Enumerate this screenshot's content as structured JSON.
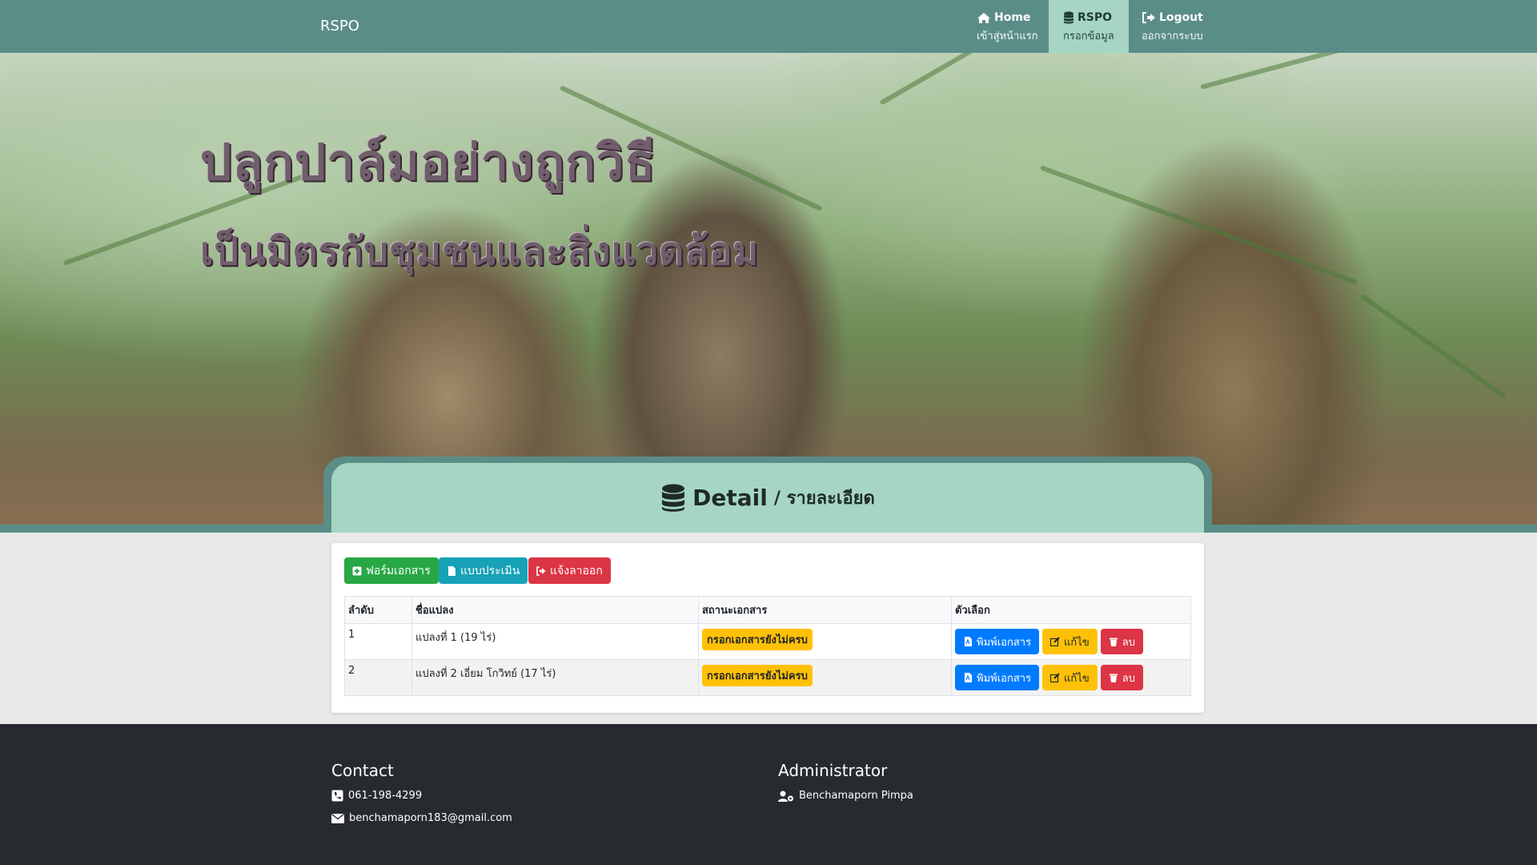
{
  "navbar": {
    "brand": "RSPO",
    "items": [
      {
        "label": "Home",
        "sublabel": "เข้าสู่หน้าแรก",
        "icon": "home-icon"
      },
      {
        "label": "RSPO",
        "sublabel": "กรอกข้อมูล",
        "icon": "database-icon",
        "active": true
      },
      {
        "label": "Logout",
        "sublabel": "ออกจากระบบ",
        "icon": "sign-out-icon"
      }
    ]
  },
  "hero": {
    "title1": "ปลูกปาล์มอย่างถูกวิธี",
    "title2": "เป็นมิตรกับชุมชนและสิ่งแวดล้อม"
  },
  "detail": {
    "title": "Detail",
    "subtitle": "/ รายละเอียด"
  },
  "actions": {
    "form": "ฟอร์มเอกสาร",
    "assessment": "แบบประเมิน",
    "notify_exit": "แจ้งลาออก"
  },
  "table": {
    "headers": [
      "ลำดับ",
      "ชื่อแปลง",
      "สถานะเอกสาร",
      "ตัวเลือก"
    ],
    "rows": [
      {
        "no": "1",
        "name": "แปลงที่ 1 (19 ไร่)",
        "status": "กรอกเอกสารยังไม่ครบ"
      },
      {
        "no": "2",
        "name": "แปลงที่ 2 เอี่ยม โกวิทย์ (17 ไร่)",
        "status": "กรอกเอกสารยังไม่ครบ"
      }
    ],
    "row_actions": {
      "print": "พิมพ์เอกสาร",
      "edit": "แก้ไข",
      "delete": "ลบ"
    }
  },
  "footer": {
    "contact_heading": "Contact",
    "phone": "061-198-4299",
    "email": "benchamaporn183@gmail.com",
    "admin_heading": "Administrator",
    "admin_name": "Benchamaporn Pimpa"
  },
  "colors": {
    "navbar": "#5b8d88",
    "active_tab": "#a6d6c3",
    "footer": "#272b2f",
    "badge": "#ffc107"
  }
}
